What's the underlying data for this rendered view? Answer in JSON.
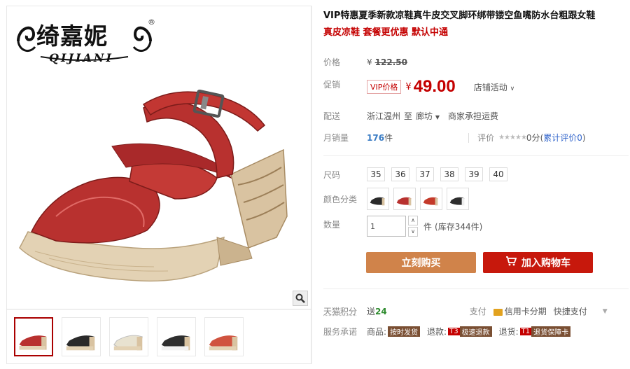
{
  "brand": {
    "name_cn": "绮嘉妮",
    "name_en": "QIJIANI",
    "reg_mark": "®"
  },
  "product": {
    "title": "VIP特惠夏季新款凉鞋真牛皮交叉脚环绑带镂空鱼嘴防水台粗跟女鞋",
    "subtitle": "真皮凉鞋 套餐更优惠 默认中通"
  },
  "price": {
    "label": "价格",
    "currency": "¥",
    "original": "122.50"
  },
  "promo": {
    "label": "促销",
    "tag": "VIP价格",
    "currency": "¥",
    "price": "49.00",
    "store_activity": "店铺活动"
  },
  "shipping": {
    "label": "配送",
    "from": "浙江温州",
    "to_word": "至",
    "destination": "廊坊",
    "fee_note": "商家承担运费"
  },
  "sales": {
    "label": "月销量",
    "count": "176",
    "unit": "件",
    "rating_label": "评价",
    "stars": "★★★★★",
    "score": "0分",
    "review_prefix": "(",
    "review_text": "累计评价0",
    "review_suffix": ")"
  },
  "size": {
    "label": "尺码",
    "options": [
      "35",
      "36",
      "37",
      "38",
      "39",
      "40"
    ]
  },
  "color": {
    "label": "颜色分类",
    "swatches": [
      "#2a2a2a",
      "#b8312f",
      "#c43a2a",
      "#2e2e2e"
    ]
  },
  "quantity": {
    "label": "数量",
    "value": "1",
    "unit": "件",
    "stock": "(库存344件)"
  },
  "buttons": {
    "buy_now": "立刻购买",
    "add_to_cart": "加入购物车"
  },
  "points": {
    "label": "天猫积分",
    "prefix": "送",
    "value": "24",
    "pay_label": "支付",
    "credit_card": "信用卡分期",
    "quick_pay": "快捷支付"
  },
  "service": {
    "label": "服务承诺",
    "goods": "商品:",
    "goods_badge": "按时发货",
    "refund": "退款:",
    "refund_badge_red": "T3",
    "refund_badge": "极速退款",
    "return": "退货:",
    "return_badge_red": "T1",
    "return_badge": "退货保障卡"
  },
  "thumbnails": [
    "#b8312f",
    "#2a2a2a",
    "#e8e2d0",
    "#2e2e2e",
    "#d0533f"
  ],
  "colors": {
    "accent_red": "#c40000",
    "buy_orange": "#d0834a",
    "cart_red": "#c7180c",
    "link_blue": "#3366cc"
  }
}
